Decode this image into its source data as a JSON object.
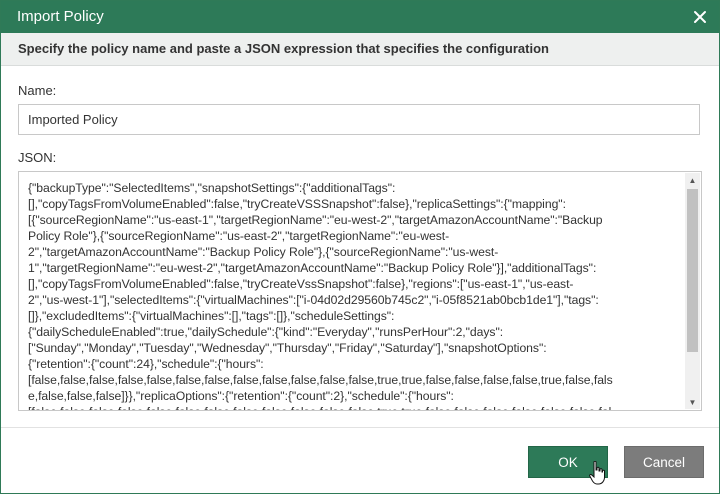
{
  "dialog": {
    "title": "Import Policy",
    "instructions": "Specify the policy name and paste a JSON expression that specifies the configuration"
  },
  "form": {
    "name_label": "Name:",
    "name_value": "Imported Policy",
    "json_label": "JSON:",
    "json_lines": [
      "{\"backupType\":\"SelectedItems\",\"snapshotSettings\":{\"additionalTags\":",
      "[],\"copyTagsFromVolumeEnabled\":false,\"tryCreateVSSSnapshot\":false},\"replicaSettings\":{\"mapping\":",
      "[{\"sourceRegionName\":\"us-east-1\",\"targetRegionName\":\"eu-west-2\",\"targetAmazonAccountName\":\"Backup",
      "Policy Role\"},{\"sourceRegionName\":\"us-east-2\",\"targetRegionName\":\"eu-west-",
      "2\",\"targetAmazonAccountName\":\"Backup Policy Role\"},{\"sourceRegionName\":\"us-west-",
      "1\",\"targetRegionName\":\"eu-west-2\",\"targetAmazonAccountName\":\"Backup Policy Role\"}],\"additionalTags\":",
      "[],\"copyTagsFromVolumeEnabled\":false,\"tryCreateVssSnapshot\":false},\"regions\":[\"us-east-1\",\"us-east-",
      "2\",\"us-west-1\"],\"selectedItems\":{\"virtualMachines\":[\"i-04d02d29560b745c2\",\"i-05f8521ab0bcb1de1\"],\"tags\":",
      "[]},\"excludedItems\":{\"virtualMachines\":[],\"tags\":[]},\"scheduleSettings\":",
      "{\"dailyScheduleEnabled\":true,\"dailySchedule\":{\"kind\":\"Everyday\",\"runsPerHour\":2,\"days\":",
      "[\"Sunday\",\"Monday\",\"Tuesday\",\"Wednesday\",\"Thursday\",\"Friday\",\"Saturday\"],\"snapshotOptions\":",
      "{\"retention\":{\"count\":24},\"schedule\":{\"hours\":",
      "[false,false,false,false,false,false,false,false,false,false,false,false,true,true,false,false,false,false,true,false,fals",
      "e,false,false,false]}},\"replicaOptions\":{\"retention\":{\"count\":2},\"schedule\":{\"hours\":",
      "[false,false,false,false,false,false,false,false,false,false,false,false,true,true,false,false,false,false,false,false,fal"
    ]
  },
  "buttons": {
    "ok": "OK",
    "cancel": "Cancel"
  },
  "colors": {
    "accent": "#2d7a58",
    "cancel_bg": "#7c7c7c"
  }
}
